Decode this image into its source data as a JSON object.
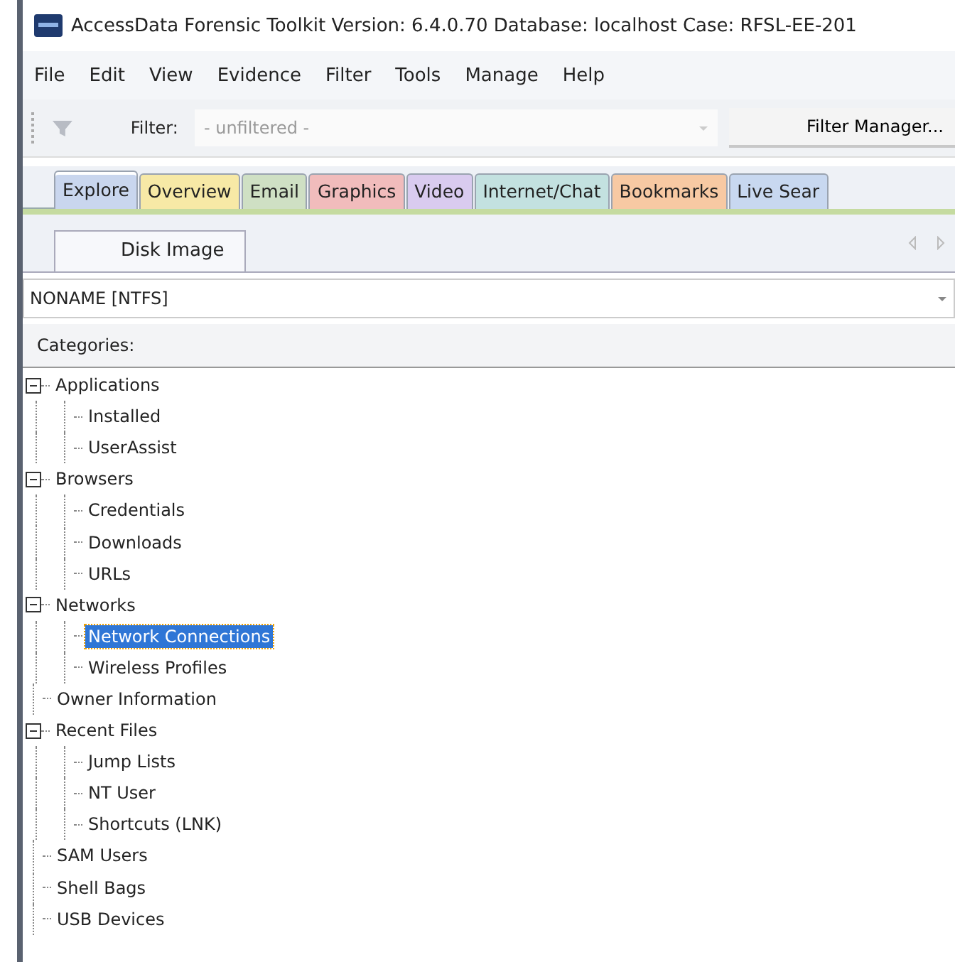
{
  "window": {
    "title": "AccessData Forensic Toolkit Version: 6.4.0.70 Database: localhost Case: RFSL-EE-201"
  },
  "menu": [
    {
      "label": "File"
    },
    {
      "label": "Edit"
    },
    {
      "label": "View"
    },
    {
      "label": "Evidence"
    },
    {
      "label": "Filter"
    },
    {
      "label": "Tools"
    },
    {
      "label": "Manage"
    },
    {
      "label": "Help"
    }
  ],
  "filter_bar": {
    "label": "Filter:",
    "value": "- unfiltered -",
    "button": "Filter Manager..."
  },
  "tabs": [
    {
      "label": "Explore",
      "color": "#c9d6ee",
      "selected": true
    },
    {
      "label": "Overview",
      "color": "#f7e9a6",
      "selected": false
    },
    {
      "label": "Email",
      "color": "#cfe0c4",
      "selected": false
    },
    {
      "label": "Graphics",
      "color": "#f1bcbc",
      "selected": false
    },
    {
      "label": "Video",
      "color": "#d9cbef",
      "selected": false
    },
    {
      "label": "Internet/Chat",
      "color": "#c3e1e0",
      "selected": false
    },
    {
      "label": "Bookmarks",
      "color": "#f7c9a3",
      "selected": false
    },
    {
      "label": "Live Sear",
      "color": "#c8d8f0",
      "selected": false
    }
  ],
  "sub_tabs": [
    {
      "label": "Disk Image",
      "selected": true
    }
  ],
  "evidence_selector": {
    "value": "NONAME [NTFS]"
  },
  "categories": {
    "header": "Categories:",
    "tree": [
      {
        "label": "Applications",
        "expanded": true,
        "selected": false,
        "children": [
          {
            "label": "Installed",
            "selected": false
          },
          {
            "label": "UserAssist",
            "selected": false
          }
        ]
      },
      {
        "label": "Browsers",
        "expanded": true,
        "selected": false,
        "children": [
          {
            "label": "Credentials",
            "selected": false
          },
          {
            "label": "Downloads",
            "selected": false
          },
          {
            "label": "URLs",
            "selected": false
          }
        ]
      },
      {
        "label": "Networks",
        "expanded": true,
        "selected": false,
        "children": [
          {
            "label": "Network Connections",
            "selected": true
          },
          {
            "label": "Wireless Profiles",
            "selected": false
          }
        ]
      },
      {
        "label": "Owner Information",
        "selected": false
      },
      {
        "label": "Recent Files",
        "expanded": true,
        "selected": false,
        "children": [
          {
            "label": "Jump Lists",
            "selected": false
          },
          {
            "label": "NT User",
            "selected": false
          },
          {
            "label": "Shortcuts (LNK)",
            "selected": false
          }
        ]
      },
      {
        "label": "SAM Users",
        "selected": false
      },
      {
        "label": "Shell Bags",
        "selected": false
      },
      {
        "label": "USB Devices",
        "selected": false
      }
    ]
  }
}
